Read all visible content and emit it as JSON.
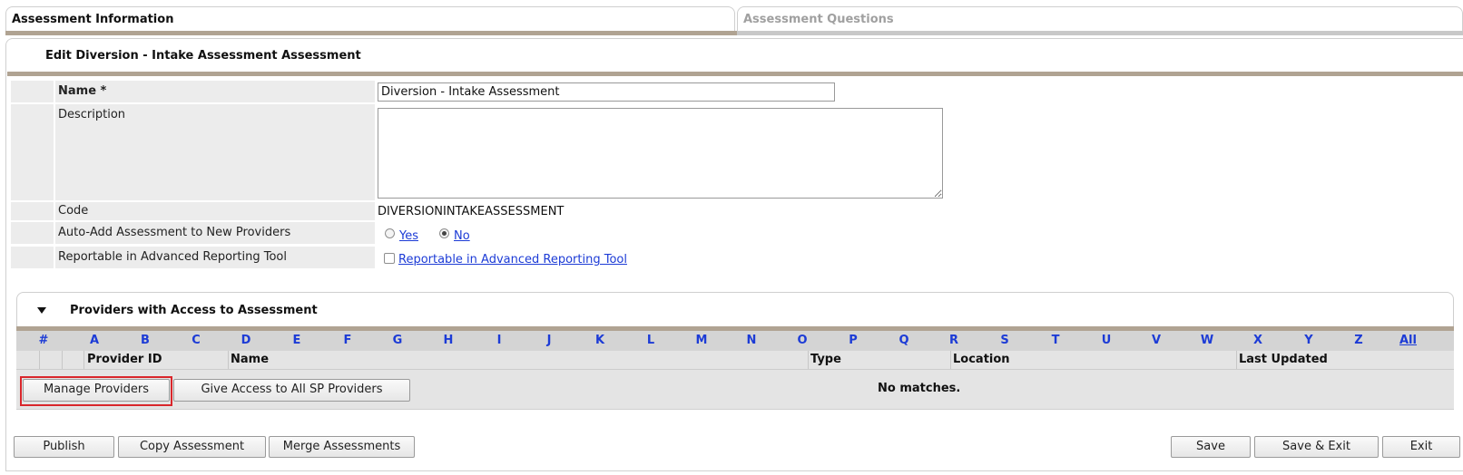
{
  "tabs": [
    {
      "label": "Assessment Information",
      "active": true
    },
    {
      "label": "Assessment Questions",
      "active": false
    }
  ],
  "edit_title": "Edit Diversion - Intake Assessment Assessment",
  "form": {
    "name_label": "Name *",
    "name_value": "Diversion - Intake Assessment",
    "description_label": "Description",
    "description_value": "",
    "code_label": "Code",
    "code_value": "DIVERSIONINTAKEASSESSMENT",
    "auto_add_label": "Auto-Add Assessment to New Providers",
    "auto_add_yes": "Yes",
    "auto_add_no": "No",
    "auto_add_selected": "No",
    "reportable_label": "Reportable in Advanced Reporting Tool",
    "reportable_checkbox_label": "Reportable in Advanced Reporting Tool",
    "reportable_checked": false
  },
  "providers": {
    "title": "Providers with Access to Assessment",
    "alphabet": [
      "#",
      "A",
      "B",
      "C",
      "D",
      "E",
      "F",
      "G",
      "H",
      "I",
      "J",
      "K",
      "L",
      "M",
      "N",
      "O",
      "P",
      "Q",
      "R",
      "S",
      "T",
      "U",
      "V",
      "W",
      "X",
      "Y",
      "Z"
    ],
    "all_label": "All",
    "columns": {
      "provider_id": "Provider ID",
      "name": "Name",
      "type": "Type",
      "location": "Location",
      "last_updated": "Last Updated"
    },
    "manage_button": "Manage Providers",
    "give_access_button": "Give Access to All SP Providers",
    "empty_text": "No matches."
  },
  "footer": {
    "publish": "Publish",
    "copy": "Copy Assessment",
    "merge": "Merge Assessments",
    "save": "Save",
    "save_exit": "Save & Exit",
    "exit": "Exit"
  },
  "colors": {
    "accent_rule": "#b0a392",
    "link": "#1c3bd6",
    "highlight": "#d9262b"
  }
}
